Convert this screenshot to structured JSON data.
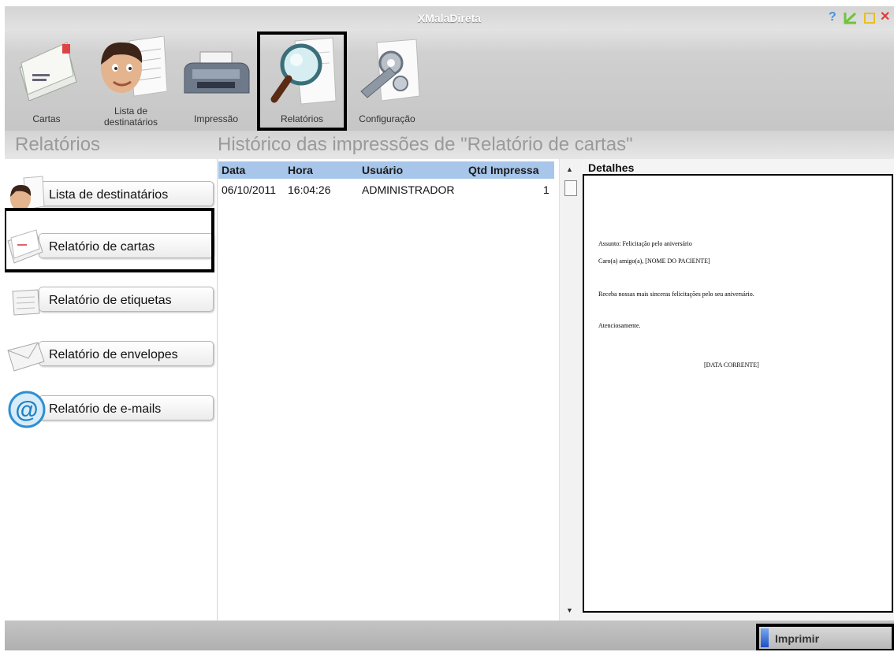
{
  "window": {
    "title": "XMalaDireta",
    "controls": [
      "help-icon",
      "minimize-icon",
      "maximize-icon",
      "close-icon"
    ]
  },
  "toolbar": {
    "items": [
      {
        "label": "Cartas",
        "icon": "letters-icon"
      },
      {
        "label": "Lista de\ndestinatários",
        "icon": "recipient-list-icon"
      },
      {
        "label": "Impressão",
        "icon": "printer-icon"
      },
      {
        "label": "Relatórios",
        "icon": "magnifier-report-icon",
        "selected": true
      },
      {
        "label": "Configuração",
        "icon": "settings-gear-icon"
      }
    ]
  },
  "header": {
    "section_title": "Relatórios",
    "main_title": "Histórico das impressões de \"Relatório de cartas\""
  },
  "sidebar": {
    "items": [
      {
        "label": "Lista de destinatários",
        "icon": "person-icon"
      },
      {
        "label": "Relatório de cartas",
        "icon": "envelope-letter-icon",
        "selected": true
      },
      {
        "label": "Relatório de etiquetas",
        "icon": "labels-icon"
      },
      {
        "label": "Relatório de envelopes",
        "icon": "envelope-icon"
      },
      {
        "label": "Relatório de e-mails",
        "icon": "at-sign-icon"
      }
    ]
  },
  "table": {
    "columns": [
      "Data",
      "Hora",
      "Usuário",
      "Qtd Impressa"
    ],
    "rows": [
      {
        "data": "06/10/2011",
        "hora": "16:04:26",
        "usuario": "ADMINISTRADOR",
        "qtd": "1"
      }
    ]
  },
  "details": {
    "label": "Detalhes",
    "lines": [
      "Assunto: Felicitação pelo aniversário",
      "Caro(a) amigo(a), [NOME DO PACIENTE]",
      "Receba nossas mais sinceras felicitações pelo seu aniversário.",
      "Atenciosamente.",
      "[DATA CORRENTE]"
    ]
  },
  "footer": {
    "print_label": "Imprimir"
  },
  "colors": {
    "table_header": "#a8c6ea",
    "header_text": "#9a9a9a",
    "accent_blue": "#1c4fc4"
  }
}
